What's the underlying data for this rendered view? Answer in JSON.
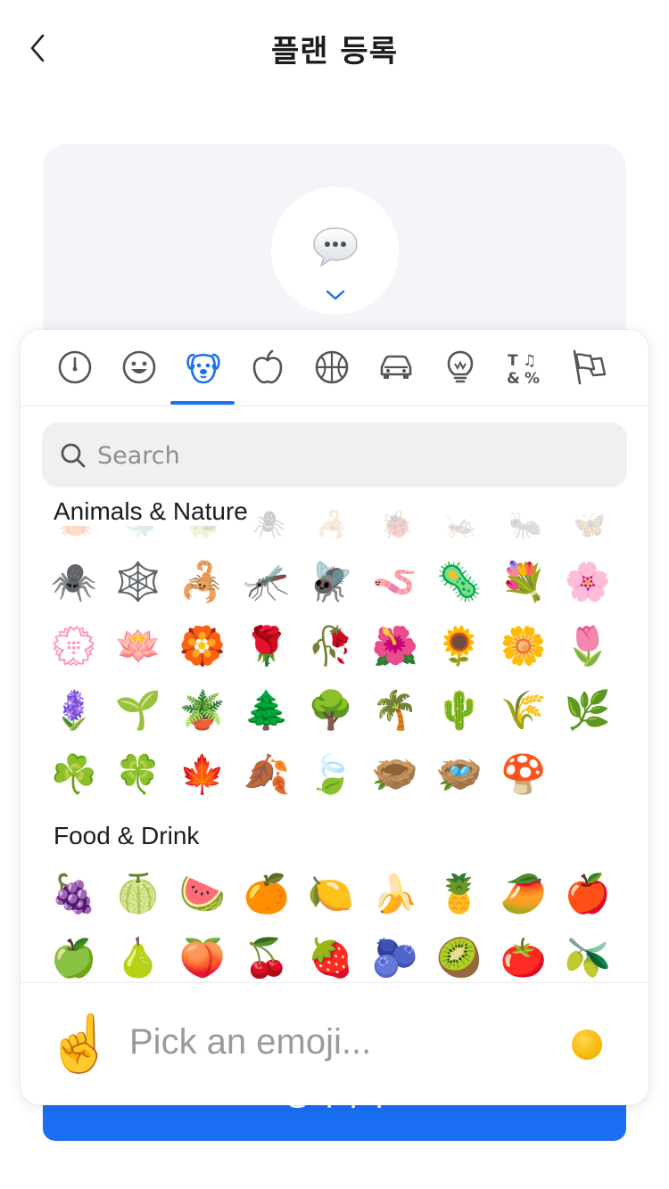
{
  "header": {
    "title": "플랜 등록"
  },
  "card": {
    "selected_emoji_icon": "speech-bubble-icon"
  },
  "submit_button": {
    "label": "등록하기"
  },
  "picker": {
    "active_tab_index": 2,
    "tabs": [
      {
        "icon": "clock-icon"
      },
      {
        "icon": "smiley-icon"
      },
      {
        "icon": "dog-icon"
      },
      {
        "icon": "apple-icon"
      },
      {
        "icon": "basketball-icon"
      },
      {
        "icon": "car-icon"
      },
      {
        "icon": "lightbulb-icon"
      },
      {
        "icon": "symbols-icon"
      },
      {
        "icon": "flags-icon"
      }
    ],
    "search": {
      "placeholder": "Search"
    },
    "sections": [
      {
        "title": "Animals & Nature",
        "faded_row": [
          "🦀",
          "🐳",
          "🐢",
          "🕷",
          "🦂",
          "🐞",
          "🦗",
          "🐜",
          "🦋"
        ],
        "rows": [
          [
            "🕷️",
            "🕸️",
            "🦂",
            "🦟",
            "🪰",
            "🪱",
            "🦠",
            "💐",
            "🌸"
          ],
          [
            "💮",
            "🪷",
            "🏵️",
            "🌹",
            "🥀",
            "🌺",
            "🌻",
            "🌼",
            "🌷"
          ],
          [
            "🪻",
            "🌱",
            "🪴",
            "🌲",
            "🌳",
            "🌴",
            "🌵",
            "🌾",
            "🌿"
          ],
          [
            "☘️",
            "🍀",
            "🍁",
            "🍂",
            "🍃",
            "🪹",
            "🪺",
            "🍄"
          ]
        ]
      },
      {
        "title": "Food & Drink",
        "rows": [
          [
            "🍇",
            "🍈",
            "🍉",
            "🍊",
            "🍋",
            "🍌",
            "🍍",
            "🥭",
            "🍎"
          ],
          [
            "🍏",
            "🍐",
            "🍑",
            "🍒",
            "🍓",
            "🫐",
            "🥝",
            "🍅",
            "🫒"
          ]
        ]
      }
    ],
    "footer": {
      "preview_emoji": "☝️",
      "placeholder": "Pick an emoji...",
      "skin_tone_color": "#f4b400"
    }
  },
  "colors": {
    "accent": "#1a6ff2",
    "card_bg": "#f4f5f8"
  }
}
